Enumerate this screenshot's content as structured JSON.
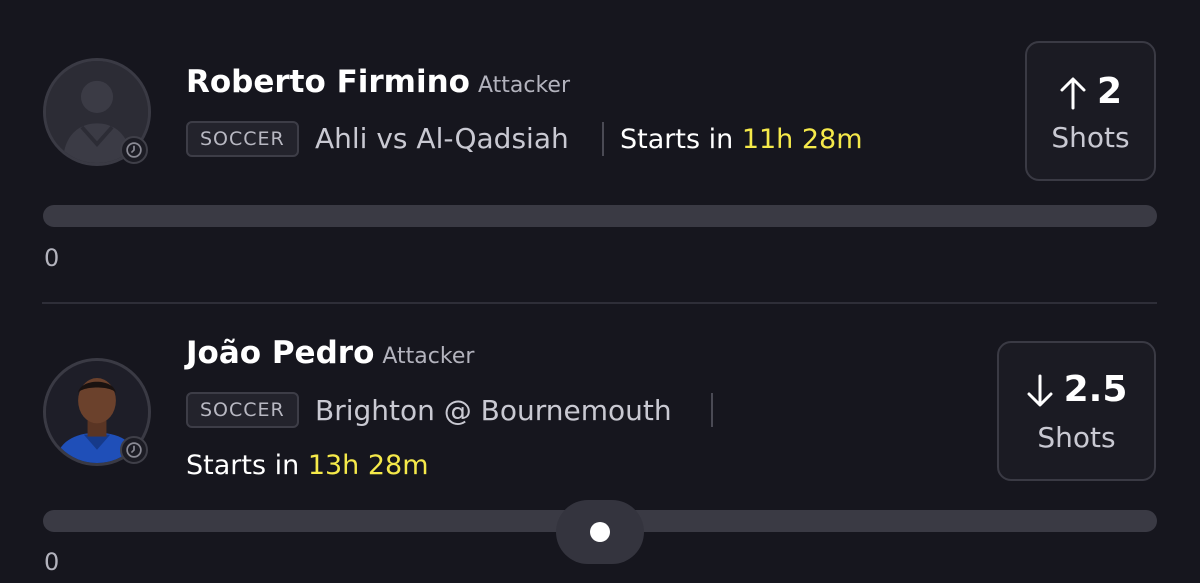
{
  "picks": [
    {
      "player_name": "Roberto Firmino",
      "position": "Attacker",
      "sport_tag": "SOCCER",
      "matchup": "Ahli vs Al-Qadsiah",
      "starts_prefix": "Starts in",
      "starts_time": "11h 28m",
      "direction": "more",
      "line_value": "2",
      "stat_label": "Shots",
      "progress_label": "0",
      "progress_value": 0
    },
    {
      "player_name": "João Pedro",
      "position": "Attacker",
      "sport_tag": "SOCCER",
      "matchup": "Brighton @ Bournemouth",
      "starts_prefix": "Starts in",
      "starts_time": "13h 28m",
      "direction": "less",
      "line_value": "2.5",
      "stat_label": "Shots",
      "progress_label": "0",
      "progress_value": 0
    }
  ],
  "colors": {
    "background": "#16161e",
    "accent_time": "#f5e94a",
    "track": "#3a3a44"
  },
  "icons": {
    "avatar_placeholder": "person-silhouette-icon",
    "clock": "clock-icon",
    "up": "arrow-up-icon",
    "down": "arrow-down-icon"
  }
}
